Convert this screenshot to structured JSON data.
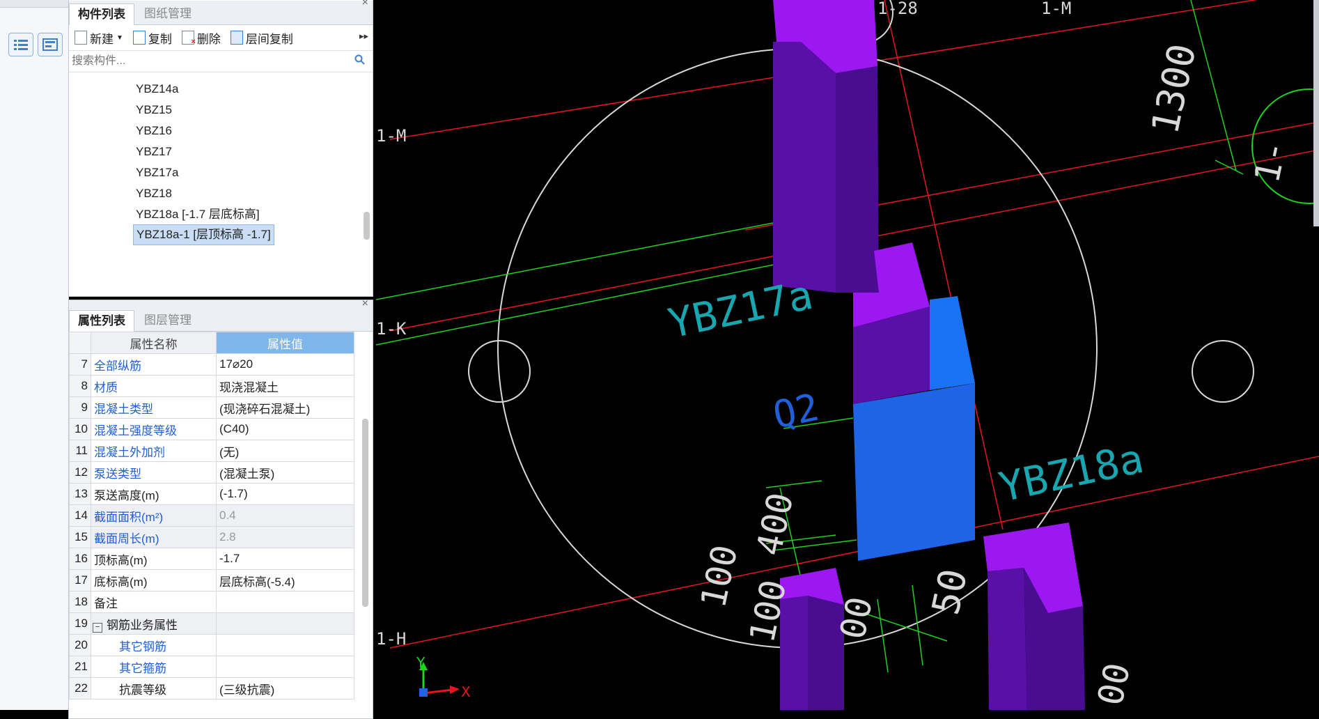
{
  "component_panel": {
    "tabs": [
      "构件列表",
      "图纸管理"
    ],
    "toolbar": {
      "new": "新建",
      "copy": "复制",
      "delete": "删除",
      "floor_copy": "层间复制"
    },
    "search_placeholder": "搜索构件...",
    "items": [
      "YBZ14a",
      "YBZ15",
      "YBZ16",
      "YBZ17",
      "YBZ17a",
      "YBZ18",
      "YBZ18a [-1.7 层底标高]",
      "YBZ18a-1 [层顶标高 -1.7]"
    ],
    "selected_index": 7
  },
  "property_panel": {
    "tabs": [
      "属性列表",
      "图层管理"
    ],
    "col_name": "属性名称",
    "col_value": "属性值",
    "rows": [
      {
        "n": "7",
        "name": "全部纵筋",
        "value": "17⌀20"
      },
      {
        "n": "8",
        "name": "材质",
        "value": "现浇混凝土"
      },
      {
        "n": "9",
        "name": "混凝土类型",
        "value": "(现浇碎石混凝土)"
      },
      {
        "n": "10",
        "name": "混凝土强度等级",
        "value": "(C40)"
      },
      {
        "n": "11",
        "name": "混凝土外加剂",
        "value": "(无)"
      },
      {
        "n": "12",
        "name": "泵送类型",
        "value": "(混凝土泵)"
      },
      {
        "n": "13",
        "name": "泵送高度(m)",
        "value": "(-1.7)"
      },
      {
        "n": "14",
        "name": "截面面积(m²)",
        "value": "0.4"
      },
      {
        "n": "15",
        "name": "截面周长(m)",
        "value": "2.8"
      },
      {
        "n": "16",
        "name": "顶标高(m)",
        "value": "-1.7"
      },
      {
        "n": "17",
        "name": "底标高(m)",
        "value": "层底标高(-5.4)"
      },
      {
        "n": "18",
        "name": "备注",
        "value": ""
      },
      {
        "n": "19",
        "name": "钢筋业务属性",
        "value": ""
      },
      {
        "n": "20",
        "name": "其它钢筋",
        "value": ""
      },
      {
        "n": "21",
        "name": "其它箍筋",
        "value": ""
      },
      {
        "n": "22",
        "name": "抗震等级",
        "value": "(三级抗震)"
      }
    ]
  },
  "cad": {
    "labels": {
      "axis_1_28": "1-28",
      "axis_1_m_top": "1-M",
      "axis_1_m": "1-M",
      "axis_1_k": "1-K",
      "axis_1_h": "1-H",
      "ybz17a": "YBZ17a",
      "q2": "Q2",
      "ybz18a": "YBZ18a",
      "dim_1300": "1300",
      "dim_400": "400",
      "dim_100": "100",
      "dim_100b": "100",
      "dim_50": "50",
      "dim_00": "00",
      "dim_00b": "00",
      "circle_1": "1-",
      "axis_y": "Y",
      "axis_x": "X"
    },
    "colors": {
      "axis_red": "#e8141e",
      "dim_green": "#1ed21e",
      "purple": "#9b19f0",
      "blue": "#1f64e6",
      "cyan": "#18a7b0"
    }
  }
}
